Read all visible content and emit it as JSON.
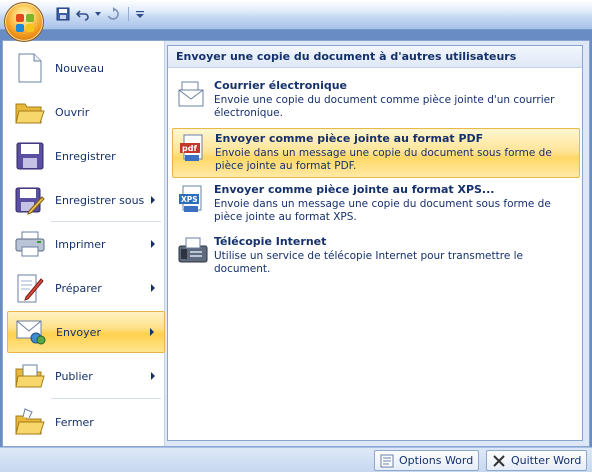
{
  "quick_access": {
    "items": [
      "save-icon",
      "undo-icon",
      "redo-icon"
    ],
    "customize_icon": "customize-icon"
  },
  "left_menu": {
    "items": [
      {
        "label": "Nouveau",
        "icon": "new-document-icon",
        "submenu": false
      },
      {
        "label": "Ouvrir",
        "icon": "open-folder-icon",
        "submenu": false
      },
      {
        "label": "Enregistrer",
        "icon": "save-disk-icon",
        "submenu": false
      },
      {
        "label": "Enregistrer sous",
        "icon": "save-as-icon",
        "submenu": true
      },
      {
        "label": "Imprimer",
        "icon": "printer-icon",
        "submenu": true
      },
      {
        "label": "Préparer",
        "icon": "prepare-icon",
        "submenu": true
      },
      {
        "label": "Envoyer",
        "icon": "send-icon",
        "submenu": true,
        "active": true
      },
      {
        "label": "Publier",
        "icon": "publish-icon",
        "submenu": true
      },
      {
        "label": "Fermer",
        "icon": "close-folder-icon",
        "submenu": false
      }
    ]
  },
  "right_panel": {
    "header": "Envoyer une copie du document à d'autres utilisateurs",
    "items": [
      {
        "title": "Courrier électronique",
        "description": "Envoie une copie du document comme pièce jointe d'un courrier électronique.",
        "icon": "email-icon"
      },
      {
        "title": "Envoyer comme pièce jointe au format PDF",
        "description": "Envoie dans un message une copie du document sous forme de pièce jointe au format PDF.",
        "icon": "pdf-icon",
        "active": true
      },
      {
        "title": "Envoyer comme pièce jointe au format XPS...",
        "description": "Envoie dans un message une copie du document sous forme de pièce jointe au format XPS.",
        "icon": "xps-icon"
      },
      {
        "title": "Télécopie Internet",
        "description": "Utilise un service de télécopie Internet pour transmettre le document.",
        "icon": "fax-icon"
      }
    ]
  },
  "bottom": {
    "options_label": "Options Word",
    "quit_label": "Quitter Word"
  },
  "colors": {
    "highlight": "#ffd867",
    "text": "#15316b",
    "frame": "#8aa6cf"
  }
}
